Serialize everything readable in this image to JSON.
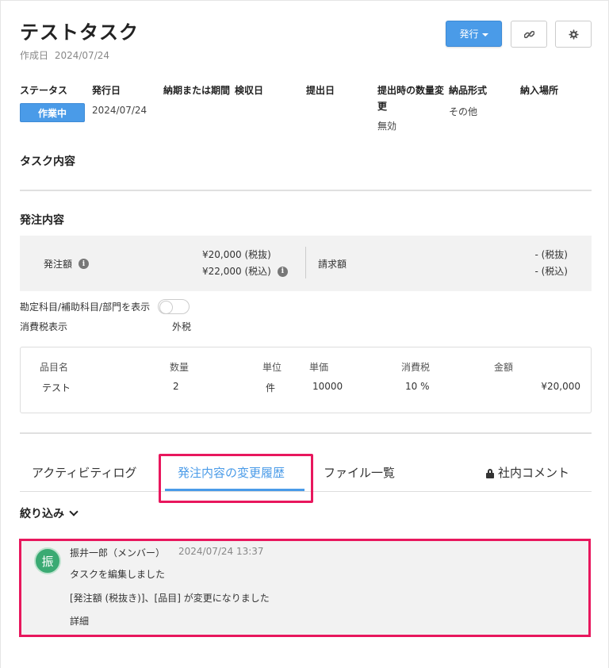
{
  "header": {
    "title": "テストタスク",
    "created_label": "作成日",
    "created_date": "2024/07/24",
    "issue_button": "発行",
    "link_icon": "link-icon",
    "gear_icon": "gear-icon"
  },
  "meta": {
    "status_label": "ステータス",
    "status_value": "作業中",
    "issue_date_label": "発行日",
    "issue_date_value": "2024/07/24",
    "due_label": "納期または期間",
    "inspection_label": "検収日",
    "submit_label": "提出日",
    "qty_change_label": "提出時の数量変更",
    "qty_change_value": "無効",
    "delivery_format_label": "納品形式",
    "delivery_format_value": "その他",
    "delivery_place_label": "納入場所"
  },
  "task_content": {
    "title": "タスク内容"
  },
  "order": {
    "title": "発注内容",
    "amount_label": "発注額",
    "amount_excl": "¥20,000 (税抜)",
    "amount_incl": "¥22,000 (税込)",
    "bill_label": "請求額",
    "bill_excl": "- (税抜)",
    "bill_incl": "- (税込)",
    "account_toggle_label": "勘定科目/補助科目/部門を表示",
    "tax_display_label": "消費税表示",
    "tax_display_value": "外税"
  },
  "items": {
    "headers": [
      "品目名",
      "数量",
      "単位",
      "単価",
      "消費税",
      "金額"
    ],
    "rows": [
      [
        "テスト",
        "2",
        "件",
        "10000",
        "10 %",
        "¥20,000"
      ]
    ]
  },
  "tabs": [
    {
      "label": "アクティビティログ"
    },
    {
      "label": "発注内容の変更履歴"
    },
    {
      "label": "ファイル一覧"
    },
    {
      "label": "社内コメント"
    }
  ],
  "filter": {
    "label": "絞り込み"
  },
  "activity": {
    "avatar_char": "振",
    "user": "振井一郎（メンバー）",
    "time": "2024/07/24 13:37",
    "line1": "タスクを編集しました",
    "line2": "[発注額 (税抜き)]、[品目] が変更になりました",
    "detail": "詳細"
  },
  "colors": {
    "accent": "#4a9be8",
    "highlight": "#e8175d",
    "avatar": "#3aaa73"
  }
}
